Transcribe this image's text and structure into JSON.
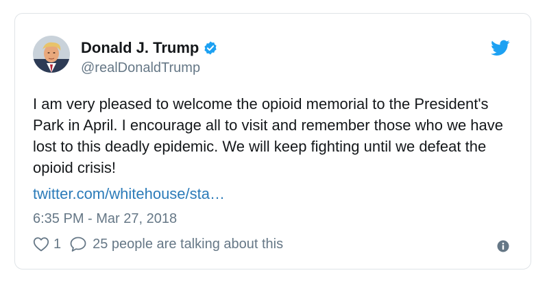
{
  "user": {
    "display_name": "Donald J. Trump",
    "handle": "@realDonaldTrump",
    "verified": true
  },
  "tweet": {
    "text": "I am very pleased to welcome the opioid memorial to the President's Park in April. I encourage all to visit and remember those who we have lost to this deadly epidemic. We will keep fighting until we defeat the opioid crisis!",
    "link": "twitter.com/whitehouse/sta…",
    "timestamp": "6:35 PM - Mar 27, 2018"
  },
  "actions": {
    "like_count": "1",
    "talking": "25 people are talking about this"
  },
  "icons": {
    "brand": "twitter-bird-icon",
    "verified": "verified-badge-icon",
    "like": "heart-icon",
    "reply": "speech-bubble-icon",
    "info": "info-icon"
  },
  "colors": {
    "twitter_blue": "#1da1f2",
    "link": "#2b7bb9",
    "text": "#14171a",
    "muted": "#657786",
    "border": "#dfe3e7"
  }
}
